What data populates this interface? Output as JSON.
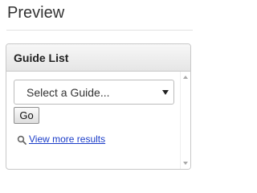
{
  "header": {
    "title": "Preview"
  },
  "panel": {
    "title": "Guide List",
    "select": {
      "selected": "Select a Guide..."
    },
    "go_label": "Go",
    "more_results_label": "View more results",
    "icons": {
      "search": "search-icon",
      "dropdown": "chevron-down-icon"
    }
  },
  "colors": {
    "link": "#1a3cc8",
    "panel_border": "#c8c8c8",
    "title_text": "#333333"
  }
}
